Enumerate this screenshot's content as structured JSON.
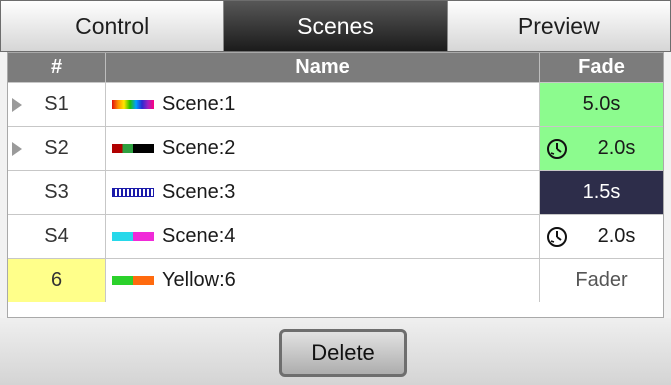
{
  "tabs": [
    {
      "label": "Control",
      "active": false
    },
    {
      "label": "Scenes",
      "active": true
    },
    {
      "label": "Preview",
      "active": false
    }
  ],
  "table": {
    "headers": {
      "num": "#",
      "name": "Name",
      "fade": "Fade"
    },
    "rows": [
      {
        "num": "S1",
        "name": "Scene:1",
        "swatch": "rainbow-swatch",
        "fade": "5.0s",
        "expandable": true,
        "fade_style": "green"
      },
      {
        "num": "S2",
        "name": "Scene:2",
        "swatch": "red-green-black-swatch",
        "fade": "2.0s",
        "expandable": true,
        "fade_style": "green",
        "fade_icon": "clock-icon"
      },
      {
        "num": "S3",
        "name": "Scene:3",
        "swatch": "blue-striped-swatch",
        "fade": "1.5s",
        "expandable": false,
        "fade_style": "navy"
      },
      {
        "num": "S4",
        "name": "Scene:4",
        "swatch": "cyan-magenta-swatch",
        "fade": "2.0s",
        "expandable": false,
        "fade_style": "plain",
        "fade_icon": "clock-icon"
      },
      {
        "num": "6",
        "name": "Yellow:6",
        "swatch": "green-orange-swatch",
        "fade": "Fader",
        "expandable": false,
        "fade_style": "gray"
      }
    ]
  },
  "footer": {
    "delete_label": "Delete"
  },
  "colors": {
    "active_tab": "#2a2a2a",
    "fade_green": "#8cfb8e",
    "fade_navy": "#2d2d4a",
    "highlight_yellow": "#ffff8a",
    "header_gray": "#7c7c7c"
  }
}
